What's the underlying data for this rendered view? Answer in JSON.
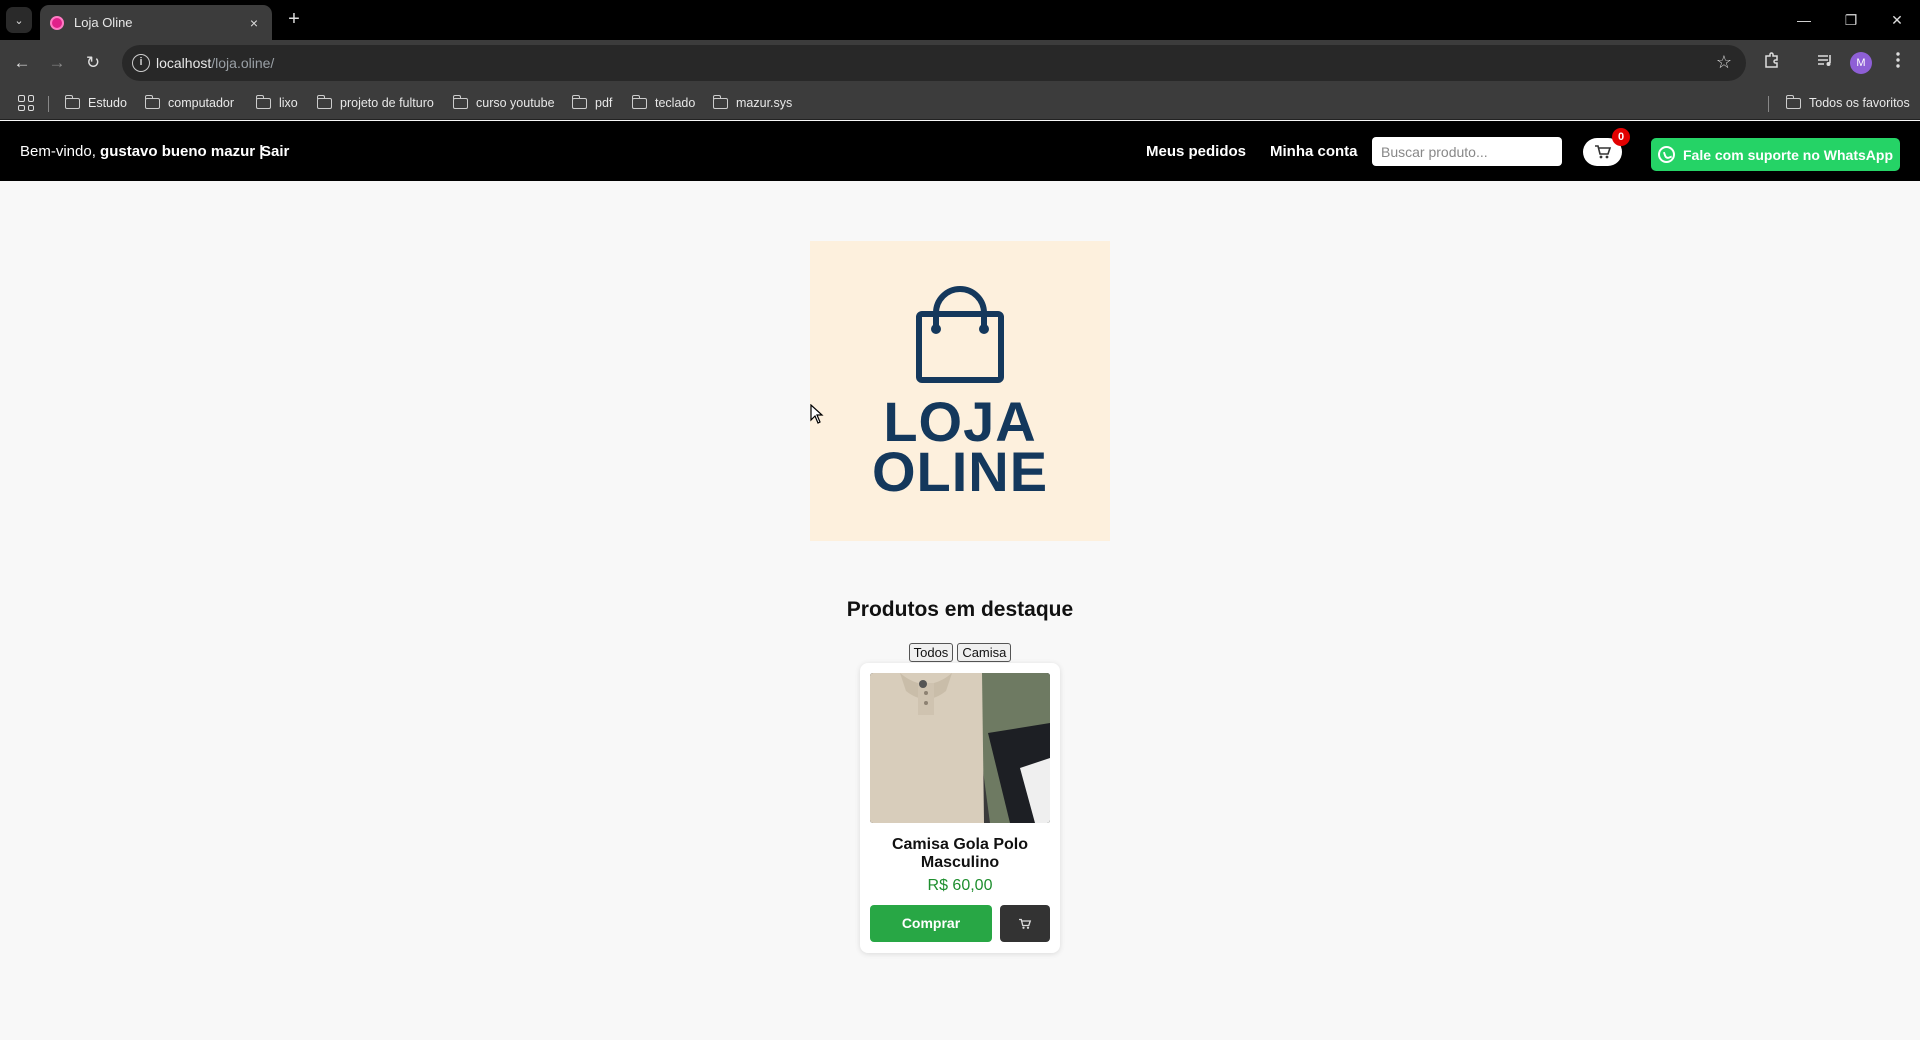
{
  "browser": {
    "tab": {
      "title": "Loja Oline",
      "close_icon": "×"
    },
    "new_tab_icon": "+",
    "tab_list_icon": "⌄",
    "window_controls": {
      "minimize": "—",
      "restore": "❐",
      "close": "✕"
    },
    "nav": {
      "back": "←",
      "forward": "→",
      "reload": "↻"
    },
    "url": {
      "host": "localhost",
      "path": "/loja.oline/"
    },
    "site_info_icon": "i",
    "bookmark_star_icon": "☆",
    "profile_initial": "M",
    "bookmarks": [
      "Estudo",
      "computador",
      "lixo",
      "projeto de fulturo",
      "curso youtube",
      "pdf",
      "teclado",
      "mazur.sys"
    ],
    "all_bookmarks_label": "Todos os favoritos"
  },
  "header": {
    "welcome_prefix": "Bem-vindo,",
    "user_name": "gustavo bueno mazur |",
    "logout_label": "Sair",
    "orders_label": "Meus pedidos",
    "account_label": "Minha conta",
    "search_placeholder": "Buscar produto...",
    "cart_count": "0",
    "whatsapp_label": "Fale com suporte no WhatsApp"
  },
  "logo": {
    "line1": "LOJA",
    "line2": "OLINE"
  },
  "featured": {
    "title": "Produtos em destaque",
    "filters": [
      "Todos",
      "Camisa"
    ],
    "products": [
      {
        "name": "Camisa Gola Polo Masculino",
        "price": "R$ 60,00",
        "buy_label": "Comprar"
      }
    ]
  },
  "colors": {
    "header_bg": "#000000",
    "whatsapp": "#25d366",
    "buy": "#28a745",
    "price": "#1e8e2e",
    "logo_text": "#14385c",
    "logo_bg": "#fdf0dd",
    "badge": "#e20000"
  }
}
